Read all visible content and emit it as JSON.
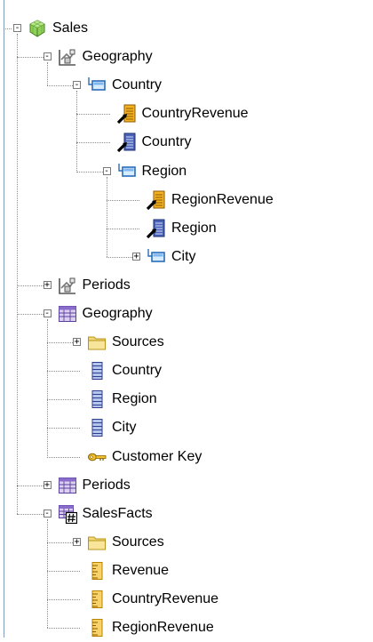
{
  "icons": {
    "cube": "cube-icon",
    "hierarchy": "hierarchy-icon",
    "level": "level-icon",
    "calc_measure": "calculated-attribute-icon",
    "attribute": "attribute-icon",
    "table": "table-icon",
    "fact_table": "fact-table-icon",
    "folder": "folder-icon",
    "column": "column-icon",
    "key": "key-icon",
    "measure": "measure-icon"
  },
  "tree": [
    {
      "id": "sales",
      "label": "Sales",
      "depth": 0,
      "icon": "cube",
      "toggle": "-",
      "children": [
        {
          "id": "geography-hier",
          "label": "Geography",
          "icon": "hierarchy",
          "toggle": "-",
          "children": [
            {
              "id": "country-level",
              "label": "Country",
              "icon": "level",
              "toggle": "-",
              "children": [
                {
                  "id": "country-revenue-attr",
                  "label": "CountryRevenue",
                  "icon": "calc_measure"
                },
                {
                  "id": "country-attr",
                  "label": "Country",
                  "icon": "attribute"
                },
                {
                  "id": "region-level",
                  "label": "Region",
                  "icon": "level",
                  "toggle": "-",
                  "children": [
                    {
                      "id": "region-revenue-attr",
                      "label": "RegionRevenue",
                      "icon": "calc_measure"
                    },
                    {
                      "id": "region-attr",
                      "label": "Region",
                      "icon": "attribute"
                    },
                    {
                      "id": "city-level",
                      "label": "City",
                      "icon": "level",
                      "toggle": "+"
                    }
                  ]
                }
              ]
            }
          ]
        },
        {
          "id": "periods-hier",
          "label": "Periods",
          "icon": "hierarchy",
          "toggle": "+"
        },
        {
          "id": "geography-table",
          "label": "Geography",
          "icon": "table",
          "toggle": "-",
          "children": [
            {
              "id": "geography-sources",
              "label": "Sources",
              "icon": "folder",
              "toggle": "+"
            },
            {
              "id": "country-column",
              "label": "Country",
              "icon": "column"
            },
            {
              "id": "region-column",
              "label": "Region",
              "icon": "column"
            },
            {
              "id": "city-column",
              "label": "City",
              "icon": "column"
            },
            {
              "id": "customer-key",
              "label": "Customer Key",
              "icon": "key"
            }
          ]
        },
        {
          "id": "periods-table",
          "label": "Periods",
          "icon": "table",
          "toggle": "+"
        },
        {
          "id": "salesfacts-table",
          "label": "SalesFacts",
          "icon": "fact_table",
          "toggle": "-",
          "children": [
            {
              "id": "salesfacts-sources",
              "label": "Sources",
              "icon": "folder",
              "toggle": "+"
            },
            {
              "id": "revenue-measure",
              "label": "Revenue",
              "icon": "measure"
            },
            {
              "id": "countryrevenue-measure",
              "label": "CountryRevenue",
              "icon": "measure"
            },
            {
              "id": "regionrevenue-measure",
              "label": "RegionRevenue",
              "icon": "measure"
            }
          ]
        }
      ]
    }
  ]
}
